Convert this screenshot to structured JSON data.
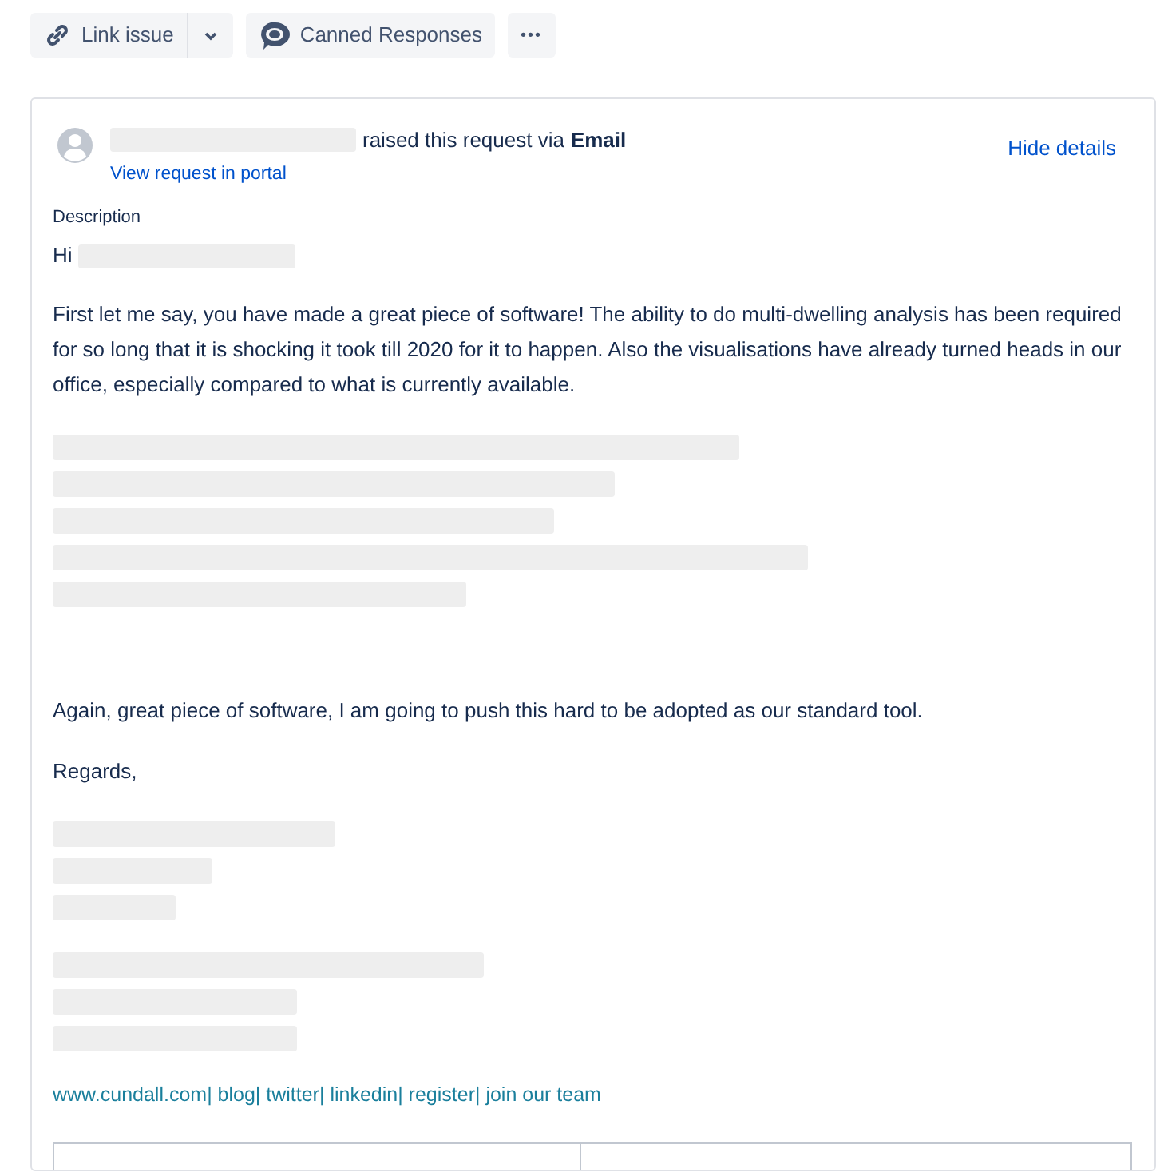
{
  "toolbar": [
    {
      "kind": "link",
      "label": "Link issue"
    },
    {
      "kind": "caret"
    },
    {
      "kind": "canned",
      "label": "Canned Responses"
    },
    {
      "kind": "more",
      "label": "•••"
    }
  ],
  "request": {
    "raised_text": "raised this request via",
    "channel": "Email",
    "portal_link": "View request in portal",
    "hide_link": "Hide details"
  },
  "description": {
    "label": "Description",
    "greeting": "Hi",
    "blocks": [
      {
        "kind": "text",
        "text": "First let me say, you have made a great piece of software! The ability to do multi-dwelling analysis has been required for so long that it is shocking it took till 2020 for it to happen. Also the visualisations have already turned heads in our office, especially compared to what is currently available."
      },
      {
        "kind": "redacted"
      },
      {
        "kind": "gap"
      },
      {
        "kind": "text",
        "text": "Again, great piece of software, I am going to push this hard to be adopted as our standard tool."
      },
      {
        "kind": "text",
        "text": "Regards,"
      },
      {
        "kind": "redacted"
      },
      {
        "kind": "redacted"
      },
      {
        "kind": "links",
        "text": "www.cundall.com| blog| twitter| linkedin| register| join our team"
      }
    ]
  }
}
